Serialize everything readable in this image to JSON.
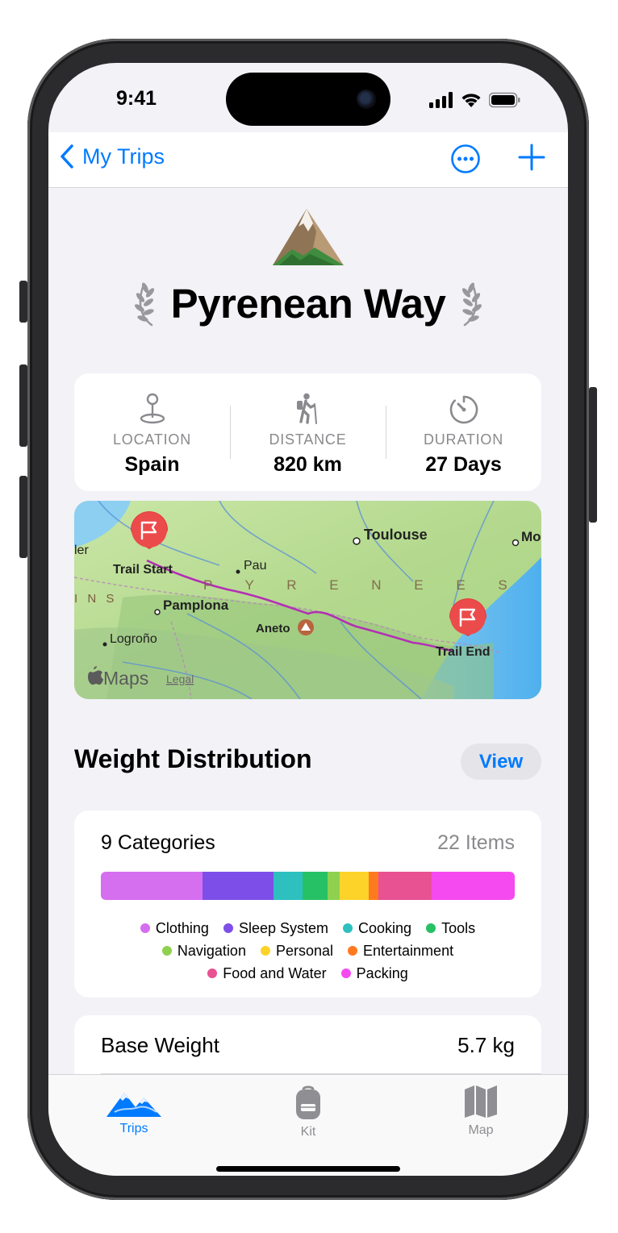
{
  "status": {
    "time": "9:41"
  },
  "nav": {
    "back_label": "My Trips"
  },
  "trip": {
    "title": "Pyrenean Way"
  },
  "stats": [
    {
      "label": "LOCATION",
      "value": "Spain",
      "icon": "map-pin-icon"
    },
    {
      "label": "DISTANCE",
      "value": "820 km",
      "icon": "hiker-icon"
    },
    {
      "label": "DURATION",
      "value": "27 Days",
      "icon": "timer-icon"
    }
  ],
  "map": {
    "places": {
      "toulouse": "Toulouse",
      "mo": "Mo",
      "pau": "Pau",
      "pamplona": "Pamplona",
      "logrono": "Logroño",
      "aneto": "Aneto",
      "ler": "ler",
      "ins": "I N S"
    },
    "pyrenees_label": "P Y R E N E E S",
    "markers": {
      "start": "Trail Start",
      "end": "Trail End"
    },
    "brand": "Maps",
    "legal": "Legal"
  },
  "weight_distribution": {
    "title": "Weight Distribution",
    "view_label": "View",
    "categories_label": "9 Categories",
    "items_label": "22 Items",
    "categories": [
      {
        "name": "Clothing",
        "color": "#d66ef0",
        "share": 0.245
      },
      {
        "name": "Sleep System",
        "color": "#7d4fe8",
        "share": 0.172
      },
      {
        "name": "Cooking",
        "color": "#2ebfbf",
        "share": 0.07
      },
      {
        "name": "Tools",
        "color": "#27c165",
        "share": 0.06
      },
      {
        "name": "Navigation",
        "color": "#8fd14f",
        "share": 0.03
      },
      {
        "name": "Personal",
        "color": "#fdd32a",
        "share": 0.07
      },
      {
        "name": "Entertainment",
        "color": "#ff7a1f",
        "share": 0.023
      },
      {
        "name": "Food and Water",
        "color": "#e85192",
        "share": 0.13
      },
      {
        "name": "Packing",
        "color": "#f54aef",
        "share": 0.2
      }
    ]
  },
  "base_weight": {
    "label": "Base Weight",
    "value": "5.7 kg"
  },
  "tabs": [
    {
      "label": "Trips",
      "icon": "mountains-icon",
      "active": true
    },
    {
      "label": "Kit",
      "icon": "backpack-icon",
      "active": false
    },
    {
      "label": "Map",
      "icon": "folded-map-icon",
      "active": false
    }
  ],
  "colors": {
    "accent": "#007aff",
    "background": "#f2f2f7"
  }
}
